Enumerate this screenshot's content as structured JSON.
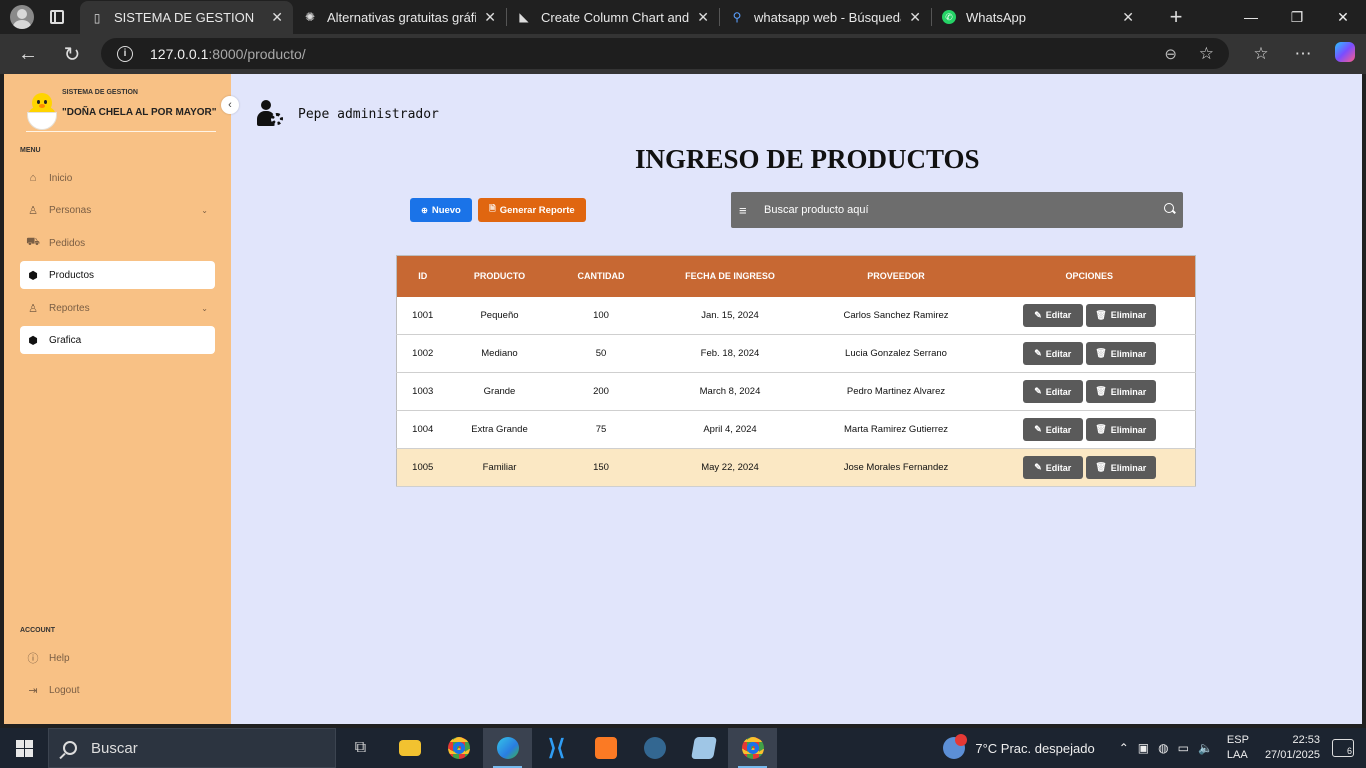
{
  "browser": {
    "tabs": [
      {
        "title": "SISTEMA DE GESTION",
        "icon": "page-icon",
        "active": true
      },
      {
        "title": "Alternativas gratuitas gráfica",
        "icon": "openai-icon"
      },
      {
        "title": "Create Column Chart and Gr",
        "icon": "chart-logo-icon"
      },
      {
        "title": "whatsapp web - Búsqueda",
        "icon": "search-icon"
      },
      {
        "title": "WhatsApp",
        "icon": "whatsapp-icon"
      }
    ],
    "url_host": "127.0.0.1",
    "url_rest": ":8000/producto/"
  },
  "sidebar": {
    "brand_sub": "SISTEMA DE GESTION",
    "brand_title": "\"DOÑA CHELA AL POR MAYOR\"",
    "menu_label": "MENU",
    "items": [
      {
        "label": "Inicio",
        "icon": "home-icon"
      },
      {
        "label": "Personas",
        "icon": "user-icon",
        "has_chevron": true
      },
      {
        "label": "Pedidos",
        "icon": "truck-icon"
      },
      {
        "label": "Productos",
        "icon": "cube-icon",
        "active": true
      },
      {
        "label": "Reportes",
        "icon": "user-icon",
        "has_chevron": true
      },
      {
        "label": "Grafica",
        "icon": "cube-icon",
        "active": true
      }
    ],
    "account_label": "ACCOUNT",
    "account_items": [
      {
        "label": "Help",
        "icon": "help-icon"
      },
      {
        "label": "Logout",
        "icon": "logout-icon"
      }
    ]
  },
  "header": {
    "user_name": "Pepe administrador"
  },
  "main": {
    "title": "INGRESO DE PRODUCTOS",
    "new_button": "Nuevo",
    "report_button": "Generar Reporte",
    "search_placeholder": "Buscar producto aquí",
    "table": {
      "headers": [
        "ID",
        "PRODUCTO",
        "CANTIDAD",
        "FECHA DE INGRESO",
        "PROVEEDOR",
        "OPCIONES"
      ],
      "rows": [
        [
          "1001",
          "Pequeño",
          "100",
          "Jan. 15, 2024",
          "Carlos Sanchez Ramirez"
        ],
        [
          "1002",
          "Mediano",
          "50",
          "Feb. 18, 2024",
          "Lucia Gonzalez Serrano"
        ],
        [
          "1003",
          "Grande",
          "200",
          "March 8, 2024",
          "Pedro Martinez Alvarez"
        ],
        [
          "1004",
          "Extra Grande",
          "75",
          "April 4, 2024",
          "Marta Ramirez Gutierrez"
        ],
        [
          "1005",
          "Familiar",
          "150",
          "May 22, 2024",
          "Jose Morales Fernandez"
        ]
      ],
      "highlighted_row": 4,
      "edit_label": "Editar",
      "delete_label": "Eliminar"
    }
  },
  "taskbar": {
    "search_label": "Buscar",
    "weather": "7°C  Prac. despejado",
    "lang_1": "ESP",
    "lang_2": "LAA",
    "time": "22:53",
    "date": "27/01/2025",
    "notifications": "6"
  },
  "colors": {
    "sidebar": "#f8c185",
    "page_bg": "#e1e5fb",
    "table_header": "#c76833",
    "nuevo": "#1a73e8",
    "reporte": "#e06610",
    "highlight_row": "#fbe8c4"
  }
}
